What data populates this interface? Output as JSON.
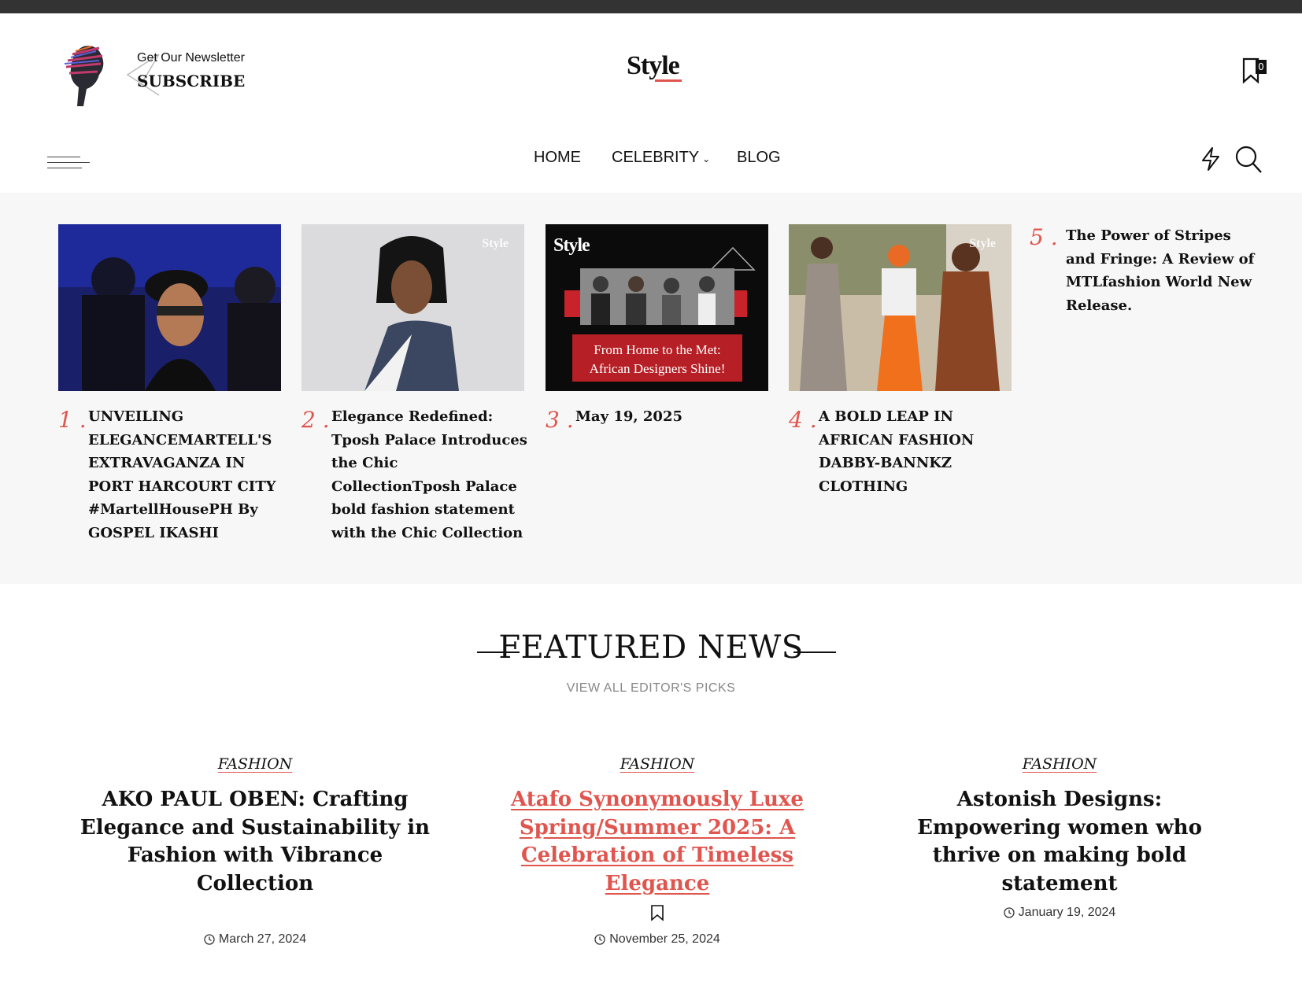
{
  "header": {
    "newsletter_small": "Get Our Newsletter",
    "newsletter_big": "SUBSCRIBE",
    "logo": "Style",
    "bookmark_count": "0"
  },
  "nav": {
    "items": [
      {
        "label": "HOME",
        "dropdown": false
      },
      {
        "label": "CELEBRITY",
        "dropdown": true
      },
      {
        "label": "BLOG",
        "dropdown": false
      }
    ]
  },
  "trending": [
    {
      "num": "1 .",
      "title": "UNVEILING ELEGANCEMARTELL'S EXTRAVAGANZA IN PORT HARCOURT CITY #MartellHousePH By GOSPEL IKASHI"
    },
    {
      "num": "2 .",
      "title": "Elegance Redefined: Tposh Palace Introduces the Chic CollectionTposh Palace bold fashion statement with the Chic Collection",
      "watermark": "Style"
    },
    {
      "num": "3 .",
      "title": "May 19, 2025",
      "banner_line1": "From Home to the Met:",
      "banner_line2": "African Designers Shine!",
      "watermark": "Style"
    },
    {
      "num": "4 .",
      "title": "A BOLD LEAP IN AFRICAN FASHION DABBY-BANNKZ CLOTHING",
      "watermark": "Style"
    },
    {
      "num": "5 .",
      "title": "The Power of Stripes and Fringe: A Review of MTLfashion World New Release."
    }
  ],
  "featured": {
    "title": "FEATURED NEWS",
    "subtitle": "VIEW ALL EDITOR'S PICKS",
    "cards": [
      {
        "category": "FASHION",
        "title": "AKO PAUL OBEN: Crafting Elegance and Sustainability in Fashion with Vibrance Collection",
        "date": "March 27, 2024"
      },
      {
        "category": "FASHION",
        "title": "Atafo Synonymously Luxe Spring/Summer 2025: A Celebration of Timeless Elegance",
        "date": "November 25, 2024"
      },
      {
        "category": "FASHION",
        "title": "Astonish Designs: Empowering women who thrive on making bold statement",
        "date": "January 19, 2024"
      }
    ]
  },
  "colors": {
    "accent": "#e0554e",
    "topbar": "#333333",
    "trending_bg": "#f7f7f7"
  }
}
